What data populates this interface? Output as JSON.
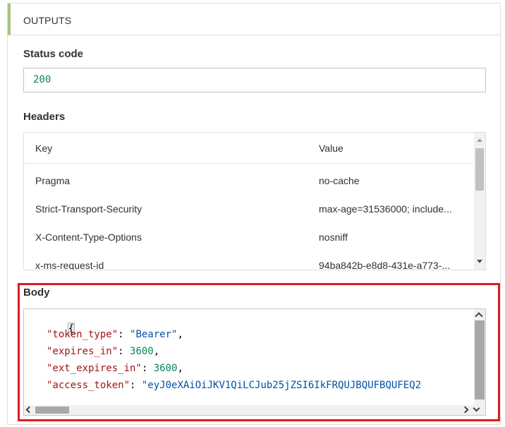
{
  "outputs": {
    "header": "OUTPUTS",
    "status": {
      "label": "Status code",
      "value": "200"
    },
    "headers": {
      "label": "Headers",
      "columns": {
        "key": "Key",
        "value": "Value"
      },
      "rows": [
        {
          "key": "Pragma",
          "value": "no-cache"
        },
        {
          "key": "Strict-Transport-Security",
          "value": "max-age=31536000; include..."
        },
        {
          "key": "X-Content-Type-Options",
          "value": "nosniff"
        },
        {
          "key": "x-ms-request-id",
          "value": "94ba842b-e8d8-431e-a773-..."
        }
      ]
    },
    "body": {
      "label": "Body",
      "open_brace": "{",
      "lines": [
        {
          "key": "\"token_type\"",
          "sep": ": ",
          "value": "\"Bearer\"",
          "value_type": "str",
          "trail": ","
        },
        {
          "key": "\"expires_in\"",
          "sep": ": ",
          "value": "3600",
          "value_type": "num",
          "trail": ","
        },
        {
          "key": "\"ext_expires_in\"",
          "sep": ": ",
          "value": "3600",
          "value_type": "num",
          "trail": ","
        },
        {
          "key": "\"access_token\"",
          "sep": ": ",
          "value": "\"eyJ0eXAiOiJKV1QiLCJub25jZSI6IkFRQUJBQUFBQUFEQ2",
          "value_type": "str",
          "trail": ""
        }
      ],
      "close_brace": "}"
    }
  },
  "colors": {
    "accent_bar": "#a9c47f",
    "highlight_border": "#e01b1b",
    "json_key": "#a31515",
    "json_string": "#0451a5",
    "json_number": "#098658"
  }
}
